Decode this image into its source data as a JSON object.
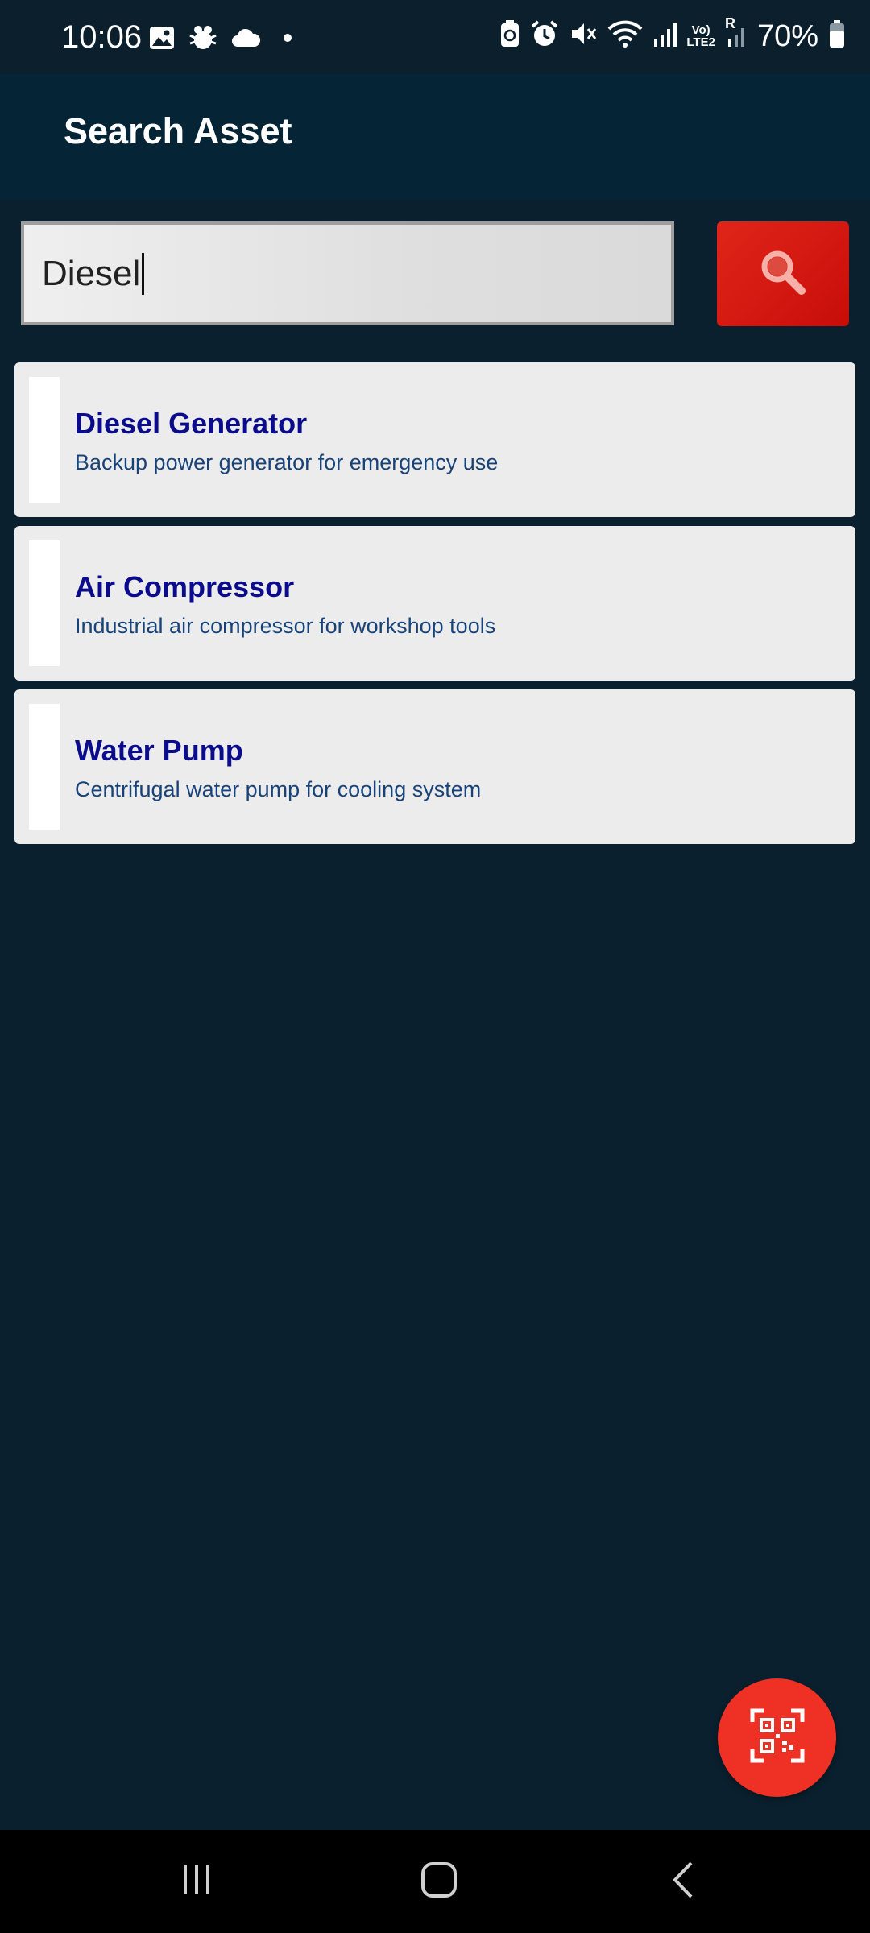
{
  "status_bar": {
    "time": "10:06",
    "battery": "70%",
    "network_top": "Vo)",
    "network_bottom": "LTE2",
    "roaming": "R",
    "left_icons": [
      "gallery-icon",
      "bug-icon",
      "cloud-icon",
      "dot-icon"
    ],
    "right_icons": [
      "battery-saver-icon",
      "alarm-icon",
      "mute-icon",
      "wifi-icon",
      "signal-icon",
      "signal-roaming-icon",
      "battery-icon"
    ]
  },
  "app_bar": {
    "title": "Search Asset"
  },
  "search": {
    "value": "Diesel",
    "button_icon": "search-icon"
  },
  "results": [
    {
      "title": "Diesel Generator",
      "description": "Backup power generator for emergency use"
    },
    {
      "title": "Air Compressor",
      "description": "Industrial air compressor for workshop tools"
    },
    {
      "title": "Water Pump",
      "description": "Centrifugal water pump for cooling system"
    }
  ],
  "fab": {
    "icon": "qr-code-scan-icon"
  },
  "nav_bar": {
    "icons": [
      "recent-apps-icon",
      "home-icon",
      "back-icon"
    ]
  },
  "colors": {
    "background": "#0a202e",
    "app_bar": "#052436",
    "accent_red": "#ee3124",
    "title_blue": "#0b0c8c",
    "desc_blue": "#17437a"
  }
}
